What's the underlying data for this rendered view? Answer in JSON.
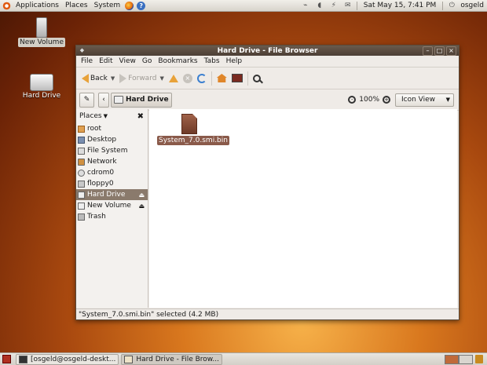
{
  "top_panel": {
    "menus": [
      "Applications",
      "Places",
      "System"
    ],
    "clock": "Sat May 15,  7:41 PM",
    "user": "osgeld"
  },
  "desktop": {
    "icons": [
      {
        "label": "New Volume",
        "selected": true
      },
      {
        "label": "Hard Drive",
        "selected": false
      }
    ]
  },
  "window": {
    "title": "Hard Drive - File Browser",
    "menubar": [
      "File",
      "Edit",
      "View",
      "Go",
      "Bookmarks",
      "Tabs",
      "Help"
    ],
    "toolbar": {
      "back_label": "Back",
      "forward_label": "Forward"
    },
    "location": {
      "crumb": "Hard Drive",
      "zoom": "100%",
      "view_mode": "Icon View"
    },
    "sidebar": {
      "header": "Places",
      "items": [
        {
          "label": "root",
          "icon": "home-folder-icon"
        },
        {
          "label": "Desktop",
          "icon": "desktop-icon"
        },
        {
          "label": "File System",
          "icon": "filesystem-icon"
        },
        {
          "label": "Network",
          "icon": "network-icon"
        },
        {
          "label": "cdrom0",
          "icon": "cdrom-icon"
        },
        {
          "label": "floppy0",
          "icon": "floppy-icon"
        },
        {
          "label": "Hard Drive",
          "icon": "drive-icon",
          "selected": true
        },
        {
          "label": "New Volume",
          "icon": "drive-icon"
        },
        {
          "label": "Trash",
          "icon": "trash-icon"
        }
      ]
    },
    "files": [
      {
        "name": "System_7.0.smi.bin",
        "selected": true
      }
    ],
    "status": "\"System_7.0.smi.bin\" selected (4.2 MB)"
  },
  "bottom_panel": {
    "tasks": [
      {
        "label": "[osgeld@osgeld-deskt...",
        "active": false
      },
      {
        "label": "Hard Drive - File Brow...",
        "active": true
      }
    ]
  },
  "colors": {
    "titlebar": "#4c3f35",
    "selection": "#8a7a6c",
    "accent_orange": "#e8a23a"
  }
}
